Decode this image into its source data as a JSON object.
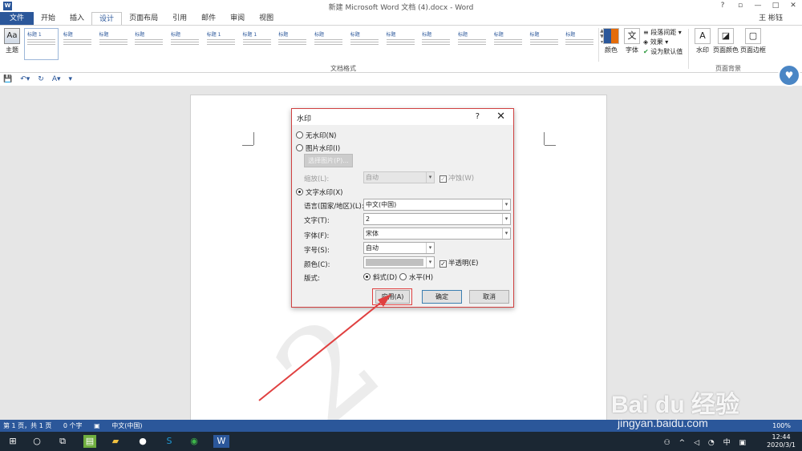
{
  "titlebar": {
    "doc_title": "新建 Microsoft Word 文档 (4).docx - Word",
    "help": "?",
    "restore": "▫",
    "minimize": "—",
    "maximize": "□",
    "close": "✕"
  },
  "tabs": [
    "文件",
    "开始",
    "插入",
    "设计",
    "页面布局",
    "引用",
    "邮件",
    "审阅",
    "视图"
  ],
  "active_tab": "设计",
  "user_name": "王 彬钰",
  "ribbon": {
    "theme_label": "主题",
    "style_titles": [
      "标题 1",
      "标题",
      "标题",
      "标题",
      "标题",
      "标题 1",
      "标题 1",
      "标题",
      "标题",
      "标题",
      "标题",
      "标题",
      "标题",
      "标题",
      "标题",
      "标题"
    ],
    "doc_format_label": "文档格式",
    "colors_label": "颜色",
    "fonts_label": "字体",
    "paragraph_spacing": "段落间距",
    "effects": "效果",
    "set_default": "设为默认值",
    "watermark_label": "水印",
    "page_color_label": "页面颜色",
    "page_border_label": "页面边框",
    "page_bg_label": "页面背景"
  },
  "dialog": {
    "title": "水印",
    "help": "?",
    "close": "✕",
    "no_watermark": "无水印(N)",
    "picture_watermark": "图片水印(I)",
    "select_picture": "选择图片(P)...",
    "scale_label": "缩放(L):",
    "scale_value": "自动",
    "washout": "冲蚀(W)",
    "text_watermark": "文字水印(X)",
    "language_label": "语言(国家/地区)(L):",
    "language_value": "中文(中国)",
    "text_label": "文字(T):",
    "text_value": "2",
    "font_label": "字体(F):",
    "font_value": "宋体",
    "size_label": "字号(S):",
    "size_value": "自动",
    "color_label": "颜色(C):",
    "semitransparent": "半透明(E)",
    "layout_label": "版式:",
    "diagonal": "斜式(D)",
    "horizontal": "水平(H)",
    "apply": "应用(A)",
    "ok": "确定",
    "cancel": "取消"
  },
  "status": {
    "page": "第 1 页，共 1 页",
    "words": "0 个字",
    "language": "中文(中国)",
    "zoom": "100%"
  },
  "taskbar": {
    "ime": "中",
    "time": "12:44",
    "date": "2020/3/1"
  },
  "watermark_brand": "Bai du 经验",
  "watermark_url": "jingyan.baidu.com",
  "colors": {
    "accent": "#2b579a",
    "dialog_border": "#d04040"
  }
}
